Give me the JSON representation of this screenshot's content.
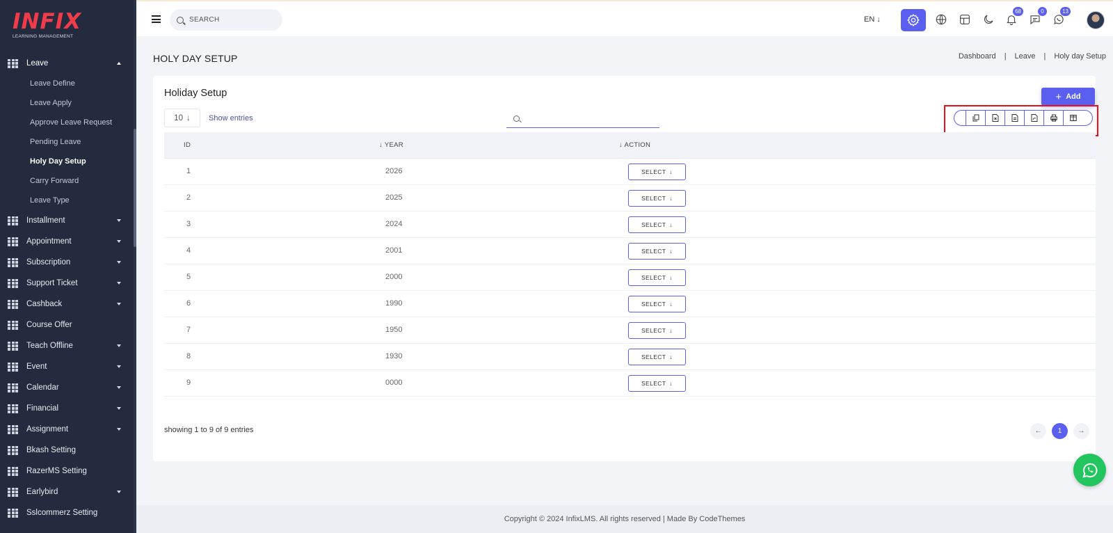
{
  "brand": {
    "name": "INFIX",
    "tagline": "LEARNING MANAGEMENT",
    "accent": "#5a5ff0",
    "logo_color": "#f03c4a"
  },
  "header": {
    "search_placeholder": "SEARCH",
    "language": "EN",
    "badges": {
      "notifications": "68",
      "messages": "0",
      "whatsapp": "13"
    }
  },
  "sidebar": {
    "open_group": {
      "label": "Leave",
      "items": [
        "Leave Define",
        "Leave Apply",
        "Approve Leave Request",
        "Pending Leave",
        "Holy Day Setup",
        "Carry Forward",
        "Leave Type"
      ],
      "active": "Holy Day Setup"
    },
    "groups": [
      {
        "label": "Installment",
        "has_children": true
      },
      {
        "label": "Appointment",
        "has_children": true
      },
      {
        "label": "Subscription",
        "has_children": true
      },
      {
        "label": "Support Ticket",
        "has_children": true
      },
      {
        "label": "Cashback",
        "has_children": true
      },
      {
        "label": "Course Offer",
        "has_children": false
      },
      {
        "label": "Teach Offline",
        "has_children": true
      },
      {
        "label": "Event",
        "has_children": true
      },
      {
        "label": "Calendar",
        "has_children": true
      },
      {
        "label": "Financial",
        "has_children": true
      },
      {
        "label": "Assignment",
        "has_children": true
      },
      {
        "label": "Bkash Setting",
        "has_children": false
      },
      {
        "label": "RazerMS Setting",
        "has_children": false
      },
      {
        "label": "Earlybird",
        "has_children": true
      },
      {
        "label": "Sslcommerz Setting",
        "has_children": false
      }
    ]
  },
  "page": {
    "title": "HOLY DAY SETUP",
    "breadcrumb": [
      "Dashboard",
      "Leave",
      "Holy day Setup"
    ],
    "breadcrumb_sep": "|"
  },
  "card": {
    "title": "Holiday Setup",
    "add_label": "Add",
    "entries_value": "10",
    "show_entries_label": "Show entries",
    "export_buttons": [
      "copy-icon",
      "excel-icon",
      "csv-icon",
      "pdf-icon",
      "print-icon",
      "columns-icon"
    ],
    "columns": {
      "id": "ID",
      "year": "YEAR",
      "action": "ACTION"
    },
    "rows": [
      {
        "id": "1",
        "year": "2026",
        "action": "SELECT"
      },
      {
        "id": "2",
        "year": "2025",
        "action": "SELECT"
      },
      {
        "id": "3",
        "year": "2024",
        "action": "SELECT"
      },
      {
        "id": "4",
        "year": "2001",
        "action": "SELECT"
      },
      {
        "id": "5",
        "year": "2000",
        "action": "SELECT"
      },
      {
        "id": "6",
        "year": "1990",
        "action": "SELECT"
      },
      {
        "id": "7",
        "year": "1950",
        "action": "SELECT"
      },
      {
        "id": "8",
        "year": "1930",
        "action": "SELECT"
      },
      {
        "id": "9",
        "year": "0000",
        "action": "SELECT"
      }
    ],
    "showing_text": "showing 1 to 9 of 9 entries",
    "current_page": "1"
  },
  "footer": {
    "text": "Copyright © 2024 InfixLMS. All rights reserved | Made By CodeThemes"
  }
}
